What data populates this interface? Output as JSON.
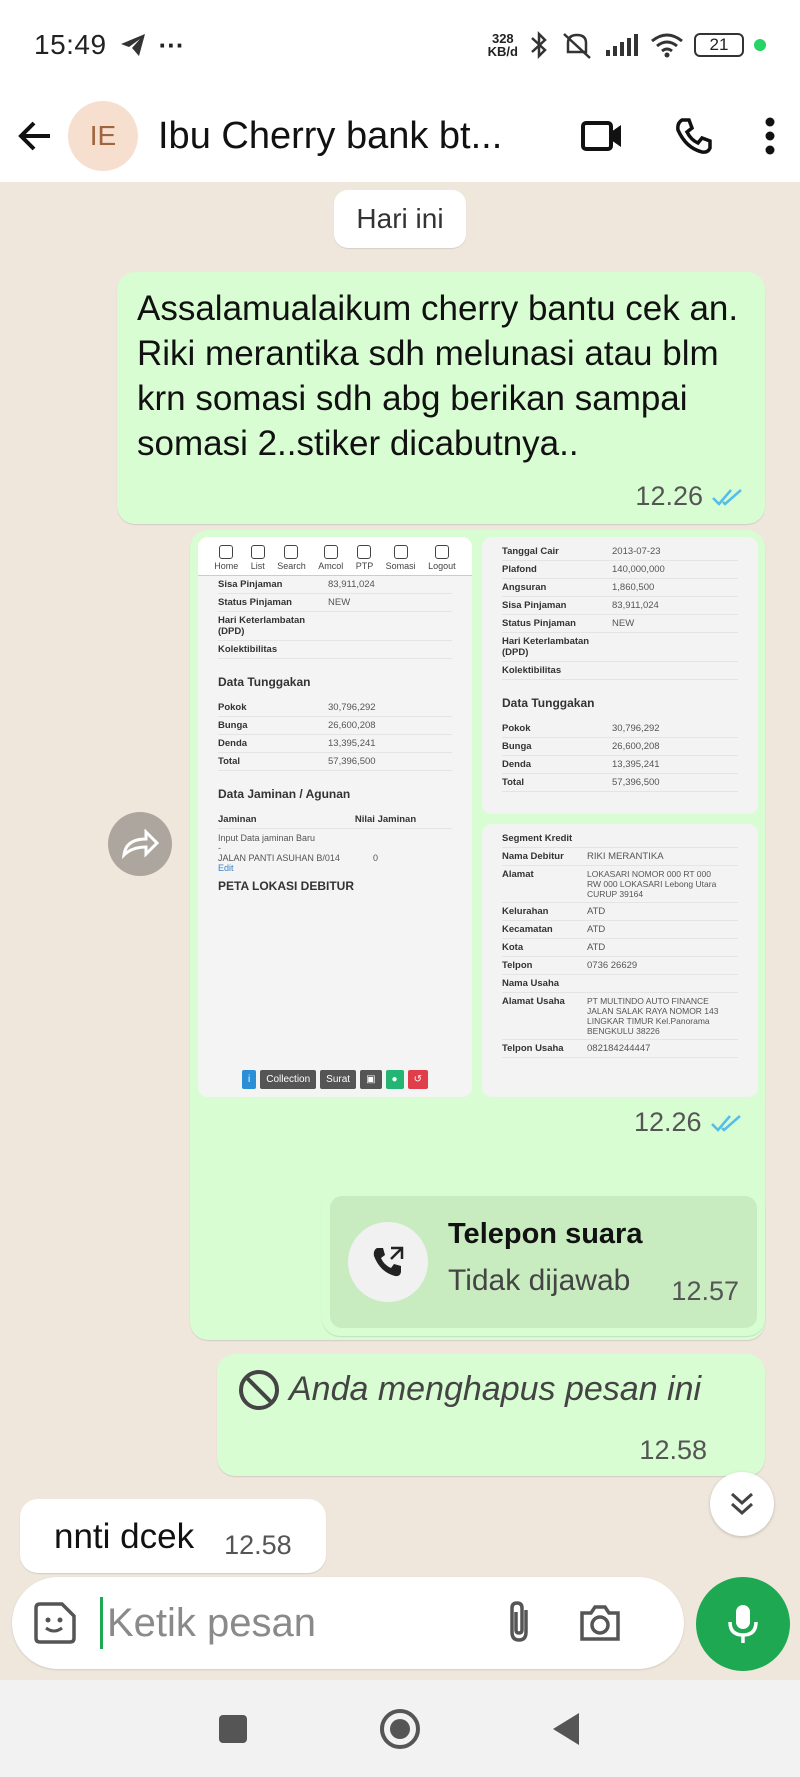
{
  "status_bar": {
    "time": "15:49",
    "extra": "···",
    "net_speed_value": "328",
    "net_speed_unit": "KB/d",
    "battery": "21"
  },
  "header": {
    "avatar_initials": "IE",
    "contact_name": "Ibu Cherry bank bt..."
  },
  "chat": {
    "day_label": "Hari ini",
    "messages": [
      {
        "text": "Assalamualaikum cherry bantu cek an. Riki merantika sdh melunasi atau blm krn somasi sdh abg berikan sampai somasi 2..stiker dicabutnya..",
        "time": "12.26"
      },
      {
        "time": "12.26"
      },
      {
        "call_title": "Telepon suara",
        "call_status": "Tidak dijawab",
        "time": "12.57"
      },
      {
        "deleted_text": "Anda menghapus pesan ini",
        "time": "12.58"
      },
      {
        "text": "nnti dcek",
        "time": "12.58"
      }
    ]
  },
  "image_left": {
    "nav": [
      "Home",
      "List",
      "Search",
      "Amcol",
      "PTP",
      "Somasi",
      "Logout"
    ],
    "top_rows": [
      {
        "k": "Sisa Pinjaman",
        "v": "83,911,024"
      },
      {
        "k": "Status Pinjaman",
        "v": "NEW"
      },
      {
        "k": "Hari Keterlambatan (DPD)",
        "v": ""
      },
      {
        "k": "Kolektibilitas",
        "v": ""
      }
    ],
    "tunggakan_title": "Data Tunggakan",
    "tunggakan": [
      {
        "k": "Pokok",
        "v": "30,796,292"
      },
      {
        "k": "Bunga",
        "v": "26,600,208"
      },
      {
        "k": "Denda",
        "v": "13,395,241"
      },
      {
        "k": "Total",
        "v": "57,396,500"
      }
    ],
    "jaminan_title": "Data Jaminan / Agunan",
    "jaminan_col1": "Jaminan",
    "jaminan_col2": "Nilai Jaminan",
    "jaminan_lines": [
      "Input Data jaminan Baru",
      "-",
      "JALAN PANTI ASUHAN B/014"
    ],
    "jaminan_value": "0",
    "jaminan_edit": "Edit",
    "peta_title": "PETA LOKASI DEBITUR",
    "buttons": [
      "i",
      "Collection",
      "Surat",
      "▣",
      "●",
      "↺"
    ]
  },
  "image_right": {
    "rows_top": [
      {
        "k": "Tanggal Cair",
        "v": "2013-07-23"
      },
      {
        "k": "Plafond",
        "v": "140,000,000"
      },
      {
        "k": "Angsuran",
        "v": "1,860,500"
      },
      {
        "k": "Sisa Pinjaman",
        "v": "83,911,024"
      },
      {
        "k": "Status Pinjaman",
        "v": "NEW"
      },
      {
        "k": "Hari Keterlambatan (DPD)",
        "v": ""
      },
      {
        "k": "Kolektibilitas",
        "v": ""
      }
    ],
    "tunggakan_title": "Data Tunggakan",
    "tunggakan": [
      {
        "k": "Pokok",
        "v": "30,796,292"
      },
      {
        "k": "Bunga",
        "v": "26,600,208"
      },
      {
        "k": "Denda",
        "v": "13,395,241"
      },
      {
        "k": "Total",
        "v": "57,396,500"
      }
    ],
    "debitur": [
      {
        "k": "Segment Kredit",
        "v": ""
      },
      {
        "k": "Nama Debitur",
        "v": "RIKI MERANTIKA"
      },
      {
        "k": "Alamat",
        "v": "LOKASARI NOMOR 000 RT 000 RW 000 LOKASARI Lebong Utara CURUP 39164"
      },
      {
        "k": "Kelurahan",
        "v": "ATD"
      },
      {
        "k": "Kecamatan",
        "v": "ATD"
      },
      {
        "k": "Kota",
        "v": "ATD"
      },
      {
        "k": "Telpon",
        "v": "0736 26629"
      },
      {
        "k": "Nama Usaha",
        "v": ""
      },
      {
        "k": "Alamat Usaha",
        "v": "PT MULTINDO AUTO FINANCE JALAN SALAK RAYA NOMOR 143 LINGKAR TIMUR Kel.Panorama BENGKULU 38226"
      },
      {
        "k": "Telpon Usaha",
        "v": "082184244447"
      }
    ]
  },
  "composer": {
    "placeholder": "Ketik pesan"
  },
  "colors": {
    "outgoing_bubble": "#d9fdd3",
    "incoming_bubble": "#ffffff",
    "accent_green": "#1da851",
    "read_tick": "#53bdeb"
  }
}
